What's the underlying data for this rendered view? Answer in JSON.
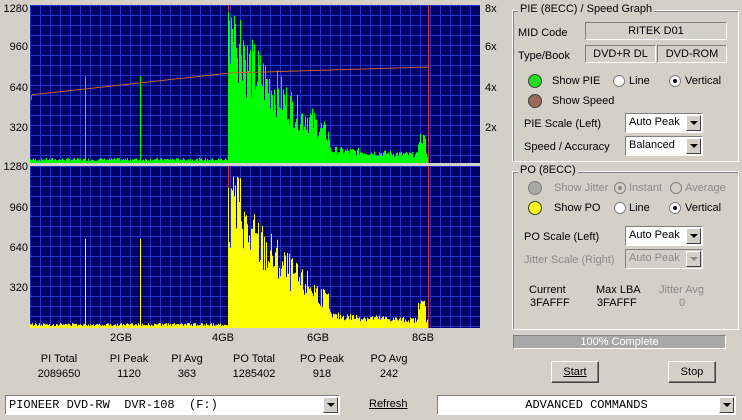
{
  "pie_chart": {
    "y_ticks": [
      "1280",
      "960",
      "640",
      "320"
    ],
    "speed_ticks": [
      "8x",
      "6x",
      "4x",
      "2x"
    ]
  },
  "po_chart": {
    "y_ticks": [
      "1280",
      "960",
      "640",
      "320"
    ]
  },
  "x_ticks": [
    "2GB",
    "4GB",
    "6GB",
    "8GB"
  ],
  "stats": [
    {
      "label": "PI Total",
      "value": "2089650"
    },
    {
      "label": "PI Peak",
      "value": "1120"
    },
    {
      "label": "PI Avg",
      "value": "363"
    },
    {
      "label": "PO Total",
      "value": "1285402"
    },
    {
      "label": "PO Peak",
      "value": "918"
    },
    {
      "label": "PO Avg",
      "value": "242"
    }
  ],
  "pie_group": {
    "title": "PIE (8ECC) / Speed Graph",
    "mid_label": "MID Code",
    "mid_value": "RITEK   D01",
    "type_label": "Type/Book",
    "type_value": "DVD+R DL",
    "book_value": "DVD-ROM",
    "show_pie": "Show PIE",
    "line": "Line",
    "vertical": "Vertical",
    "show_speed": "Show Speed",
    "pie_scale_label": "PIE Scale (Left)",
    "pie_scale_value": "Auto Peak",
    "speed_acc_label": "Speed / Accuracy",
    "speed_acc_value": "Balanced"
  },
  "po_group": {
    "title": "PO (8ECC)",
    "show_jitter": "Show Jitter",
    "instant": "Instant",
    "average": "Average",
    "show_po": "Show PO",
    "line": "Line",
    "vertical": "Vertical",
    "po_scale_label": "PO Scale (Left)",
    "po_scale_value": "Auto Peak",
    "jitter_scale_label": "Jitter Scale (Right)",
    "jitter_scale_value": "Auto Peak",
    "current_label": "Current",
    "current_value": "3FAFFF",
    "maxlba_label": "Max LBA",
    "maxlba_value": "3FAFFF",
    "jitter_avg_label": "Jitter Avg",
    "jitter_avg_value": "0"
  },
  "progress_text": "100% Complete",
  "start_label": "Start",
  "stop_label": "Stop",
  "drive_value": "PIONEER DVD-RW  DVR-108  (F:)",
  "refresh_label": "Refresh",
  "advanced_value": "ADVANCED COMMANDS",
  "colors": {
    "plot_bg": "#000066",
    "grid": "#2233cc",
    "pie": "#00ff00",
    "po": "#ffff00",
    "speed": "#c86432",
    "marker": "#cc3333"
  }
}
